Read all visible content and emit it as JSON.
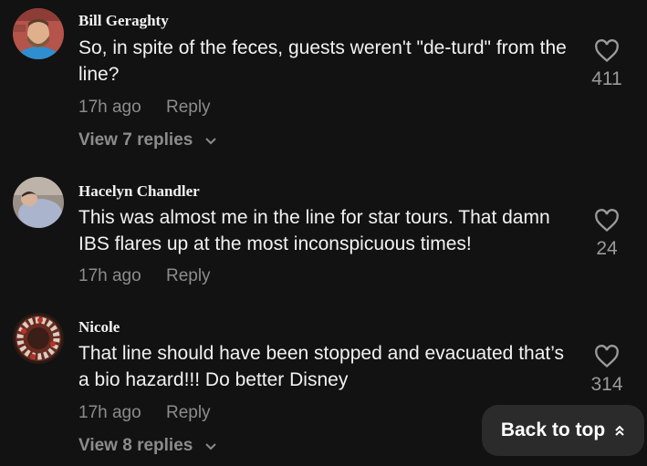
{
  "comments": [
    {
      "author": "Bill Geraghty",
      "text": "So, in spite of the feces, guests weren't \"de-turd\" from the line?",
      "time": "17h ago",
      "reply_label": "Reply",
      "likes": "411",
      "view_replies": "View 7 replies"
    },
    {
      "author": "Hacelyn Chandler",
      "text": "This was almost me in the line for star tours. That damn IBS flares up at the most inconspicuous times!",
      "time": "17h ago",
      "reply_label": "Reply",
      "likes": "24"
    },
    {
      "author": "Nicole",
      "text": "That line should have been stopped and evacuated that’s a bio hazard!!! Do better Disney",
      "time": "17h ago",
      "reply_label": "Reply",
      "likes": "314",
      "view_replies": "View 8 replies"
    }
  ],
  "back_to_top_label": "Back to top",
  "colors": {
    "background": "#121212",
    "text": "#f2f2f2",
    "muted": "#8c8c8c",
    "button_bg": "#2b2b2b"
  }
}
